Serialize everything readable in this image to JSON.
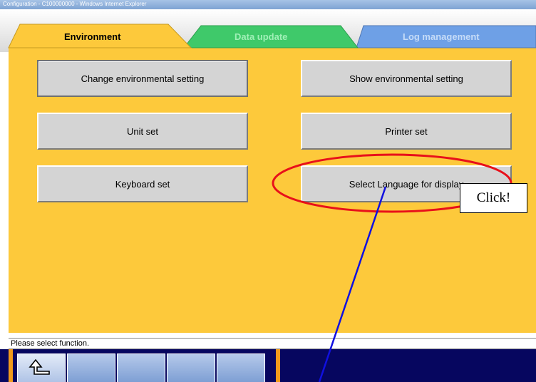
{
  "window": {
    "title": "Configuration - C100000000 - Windows Internet Explorer"
  },
  "tabs": [
    {
      "label": "Environment",
      "state": "active"
    },
    {
      "label": "Data update",
      "state": "inactive"
    },
    {
      "label": "Log management",
      "state": "inactive"
    }
  ],
  "buttons": {
    "change_env": "Change environmental setting",
    "show_env": "Show environmental setting",
    "unit_set": "Unit set",
    "printer_set": "Printer set",
    "keyboard_set": "Keyboard set",
    "select_language": "Select Language for display"
  },
  "status_bar": {
    "message": "Please select function."
  },
  "function_bar": {
    "buttons": [
      {
        "icon": "return-up-icon"
      },
      {
        "icon": ""
      },
      {
        "icon": ""
      },
      {
        "icon": ""
      },
      {
        "icon": ""
      }
    ]
  },
  "annotation": {
    "callout": "Click!"
  },
  "colors": {
    "panel": "#fdc93b",
    "tab_environment": "#fdc93b",
    "tab_data_update": "#3fc96a",
    "tab_log_management": "#6ea0e6",
    "highlight_ellipse": "#e8101a",
    "pointer_line": "#1010e0",
    "bottom_bar": "#06065f"
  }
}
